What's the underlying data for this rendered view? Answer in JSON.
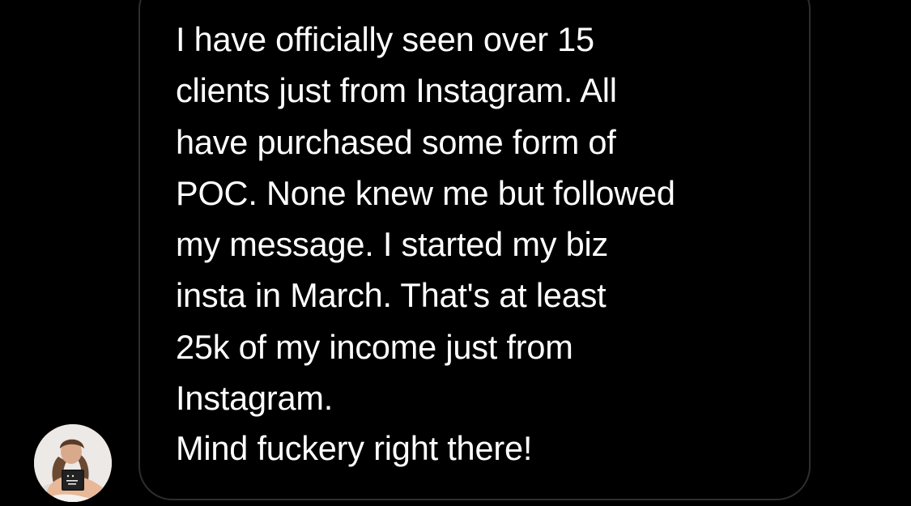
{
  "thread": {
    "message": {
      "paragraph_1": "I have officially seen over 15\nclients just from Instagram. All\nhave purchased some form of\nPOC. None knew me but followed\nmy message. I started my biz\ninsta in March. That's at least\n25k of my income just from\nInstagram.",
      "paragraph_2": "Mind fuckery right there!"
    },
    "sender": {
      "avatar_icon": "profile-photo-avatar"
    }
  },
  "colors": {
    "background": "#000000",
    "bubble_border": "#2e2e2e",
    "text": "#ffffff"
  }
}
